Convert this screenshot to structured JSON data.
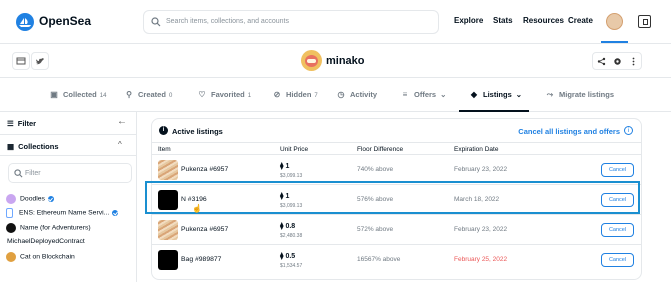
{
  "app": {
    "brand": "OpenSea"
  },
  "search": {
    "placeholder": "Search items, collections, and accounts"
  },
  "nav": {
    "explore": "Explore",
    "stats": "Stats",
    "resources": "Resources",
    "create": "Create"
  },
  "profile": {
    "name": "minako"
  },
  "tabs": [
    {
      "label": "Collected",
      "count": "14",
      "icon": "collected-icon"
    },
    {
      "label": "Created",
      "count": "0",
      "icon": "brush-icon"
    },
    {
      "label": "Favorited",
      "count": "1",
      "icon": "heart-icon"
    },
    {
      "label": "Hidden",
      "count": "7",
      "icon": "eye-off-icon"
    },
    {
      "label": "Activity",
      "count": "",
      "icon": "clock-icon"
    },
    {
      "label": "Offers",
      "count": "",
      "icon": "list-icon"
    },
    {
      "label": "Listings",
      "count": "",
      "icon": "tag-icon",
      "active": true
    },
    {
      "label": "Migrate listings",
      "count": "",
      "icon": "trend-icon"
    }
  ],
  "sidebar": {
    "filter_label": "Filter",
    "collections_label": "Collections",
    "search_placeholder": "Filter",
    "items": [
      {
        "label": "Doodles",
        "verified": true
      },
      {
        "label": "ENS: Ethereum Name Servi...",
        "verified": true
      },
      {
        "label": "Name (for Adventurers)",
        "verified": false
      },
      {
        "label": "MichaelDeployedContract",
        "verified": false
      },
      {
        "label": "Cat on Blockchain",
        "verified": false
      }
    ]
  },
  "listings": {
    "title": "Active listings",
    "cancel_all": "Cancel all listings and offers",
    "columns": [
      "Item",
      "Unit Price",
      "Floor Difference",
      "Expiration Date"
    ],
    "rows": [
      {
        "name": "Pukenza #6957",
        "price": "1",
        "usd": "$3,099.13",
        "floor": "740% above",
        "expiration": "February 23, 2022",
        "expired": false,
        "cancel": "Cancel"
      },
      {
        "name": "N #3196",
        "price": "1",
        "usd": "$3,099.13",
        "floor": "576% above",
        "expiration": "March 18, 2022",
        "expired": false,
        "cancel": "Cancel"
      },
      {
        "name": "Pukenza #6957",
        "price": "0.8",
        "usd": "$2,480.38",
        "floor": "572% above",
        "expiration": "February 23, 2022",
        "expired": false,
        "cancel": "Cancel"
      },
      {
        "name": "Bag #989877",
        "price": "0.5",
        "usd": "$1,534.57",
        "floor": "16567% above",
        "expiration": "February 25, 2022",
        "expired": true,
        "cancel": "Cancel"
      }
    ]
  },
  "colors": {
    "accent": "#2081e2",
    "highlight": "#1a8fd0",
    "danger": "#eb5757"
  }
}
